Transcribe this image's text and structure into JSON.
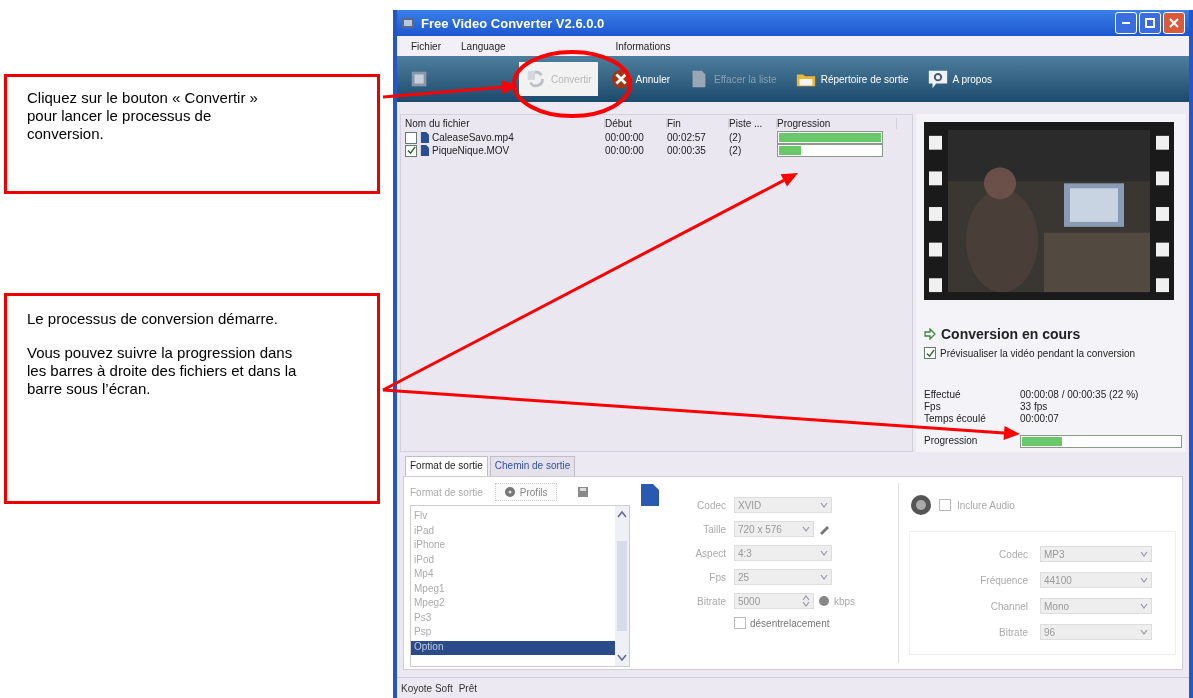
{
  "callouts": [
    {
      "paragraphs": [
        "Cliquez sur le bouton « Convertir » pour lancer le processus de conversion."
      ]
    },
    {
      "paragraphs": [
        "Le processus de conversion démarre.",
        "Vous pouvez suivre la progression dans les barres à droite des fichiers et dans la barre sous l’écran."
      ]
    }
  ],
  "window": {
    "title": "Free Video Converter V2.6.0.0"
  },
  "menu": [
    "Fichier",
    "Language",
    "Informations"
  ],
  "toolbar": [
    {
      "kind": "add",
      "highlighted": false
    },
    {
      "kind": "convert",
      "label": "Convertir",
      "disabled": true,
      "highlighted": true
    },
    {
      "kind": "cancel",
      "label": "Annuler",
      "disabled": false,
      "highlighted": false
    },
    {
      "kind": "clear",
      "label": "Effacer la liste",
      "disabled": true,
      "highlighted": false
    },
    {
      "kind": "folder",
      "label": "Répertoire de sortie",
      "disabled": false,
      "highlighted": false
    },
    {
      "kind": "about",
      "label": "A propos",
      "disabled": false,
      "highlighted": false
    }
  ],
  "files": {
    "columns": [
      "Nom du fichier",
      "Début",
      "Fin",
      "Piste ...",
      "Progression"
    ],
    "rows": [
      {
        "checked": false,
        "name": "CaleaseSavo.mp4",
        "start": "00:00:00",
        "end": "00:02:57",
        "track": "(2)",
        "level": 1
      },
      {
        "checked": true,
        "name": "PiqueNique.MOV",
        "start": "00:00:00",
        "end": "00:00:35",
        "track": "(2)",
        "level": 0.22
      }
    ]
  },
  "preview": {
    "kind": "picture",
    "status": "Conversion en cours",
    "preview_option": {
      "label": "Prévisualiser la vidéo pendant la conversion",
      "checked": true
    },
    "stats": [
      {
        "label": "Effectué",
        "value": "00:00:08 / 00:00:35  (22 %)"
      },
      {
        "label": "Fps",
        "value": "33 fps"
      },
      {
        "label": "Temps écoulé",
        "value": "00:00:07"
      }
    ],
    "progress": {
      "label": "Progression",
      "level": 0.25
    }
  },
  "bottom_tabs": [
    {
      "label": "Format de sortie",
      "selected": true
    },
    {
      "label": "Chemin de sortie",
      "selected": false
    }
  ],
  "format": {
    "label": "Format de sortie",
    "profiles_button": "Profils",
    "items": [
      {
        "label": "Flv",
        "selected": false
      },
      {
        "label": "iPad",
        "selected": false
      },
      {
        "label": "iPhone",
        "selected": false
      },
      {
        "label": "iPod",
        "selected": false
      },
      {
        "label": "Mp4",
        "selected": false
      },
      {
        "label": "Mpeg1",
        "selected": false
      },
      {
        "label": "Mpeg2",
        "selected": false
      },
      {
        "label": "Ps3",
        "selected": false
      },
      {
        "label": "Psp",
        "selected": false
      },
      {
        "label": "Option",
        "selected": true
      }
    ]
  },
  "video": {
    "fields": [
      {
        "label": "Codec",
        "value": "XVID",
        "kind": "select"
      },
      {
        "label": "Taille",
        "value": "720 x 576",
        "kind": "select-edit"
      },
      {
        "label": "Aspect",
        "value": "4:3",
        "kind": "select"
      },
      {
        "label": "Fps",
        "value": "25",
        "kind": "select"
      },
      {
        "label": "Bitrate",
        "value": "5000",
        "kind": "spin",
        "unit": "kbps"
      }
    ],
    "deinterlace": {
      "label": "désentrelacement",
      "checked": false
    }
  },
  "audio": {
    "include": {
      "label": "Inclure Audio",
      "checked": false
    },
    "fields": [
      {
        "label": "Codec",
        "value": "MP3",
        "kind": "select"
      },
      {
        "label": "Fréquence",
        "value": "44100",
        "kind": "select"
      },
      {
        "label": "Channel",
        "value": "Mono",
        "kind": "select"
      },
      {
        "label": "Bitrate",
        "value": "96",
        "kind": "select"
      }
    ]
  },
  "status_bar": [
    "Koyote Soft",
    "Prêt"
  ]
}
